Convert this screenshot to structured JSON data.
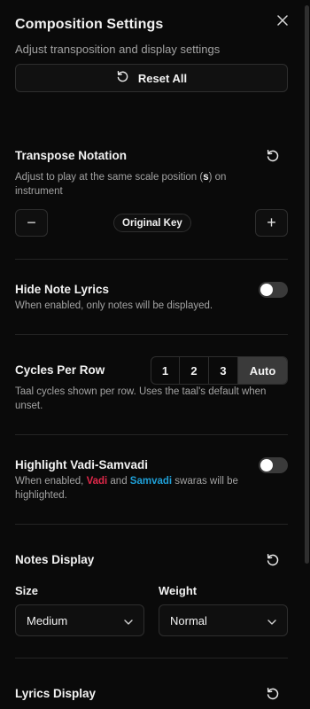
{
  "panel": {
    "title": "Composition Settings",
    "subtitle": "Adjust transposition and display settings",
    "reset_all_label": "Reset All"
  },
  "transpose": {
    "title": "Transpose Notation",
    "desc_pre": "Adjust to play at the same scale position (",
    "desc_key": "s",
    "desc_post": ") on instrument",
    "minus": "−",
    "plus": "+",
    "value": "Original Key"
  },
  "hide_lyrics": {
    "title": "Hide Note Lyrics",
    "desc": "When enabled, only notes will be displayed.",
    "enabled": false
  },
  "cycles": {
    "title": "Cycles Per Row",
    "options": [
      "1",
      "2",
      "3",
      "Auto"
    ],
    "selected": "Auto",
    "desc": "Taal cycles shown per row. Uses the taal's default when unset."
  },
  "vadi": {
    "title": "Highlight Vadi-Samvadi",
    "desc_pre": "When enabled, ",
    "vadi": "Vadi",
    "and": " and ",
    "samvadi": "Samvadi",
    "desc_post": " swaras will be highlighted.",
    "enabled": false,
    "colors": {
      "vadi": "#e0284a",
      "samvadi": "#1fa0d8"
    }
  },
  "notes_display": {
    "title": "Notes Display",
    "size_label": "Size",
    "size_value": "Medium",
    "weight_label": "Weight",
    "weight_value": "Normal"
  },
  "lyrics_display": {
    "title": "Lyrics Display"
  }
}
